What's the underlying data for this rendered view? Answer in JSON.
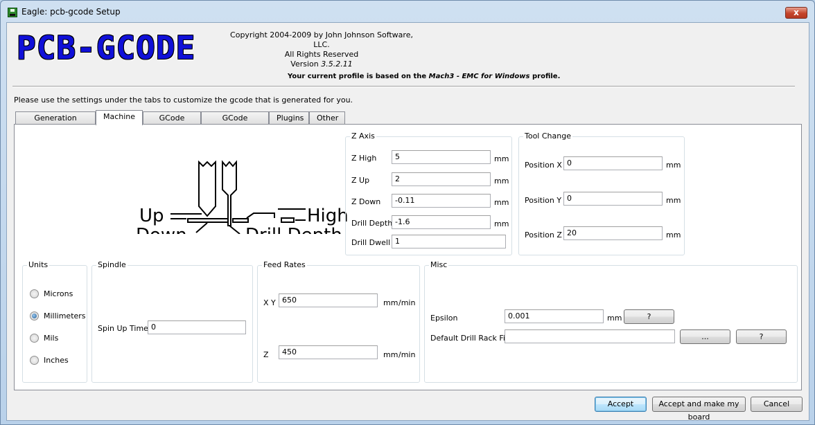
{
  "window": {
    "title": "Eagle: pcb-gcode Setup",
    "close_label": "x"
  },
  "header": {
    "logo_text": "PCB-GCODE",
    "copyright": "Copyright 2004-2009 by John Johnson Software, LLC.",
    "rights": "All Rights Reserved",
    "version_label": "Version",
    "version_value": "3.5.2.11",
    "profile_prefix": "Your current profile is based on the",
    "profile_name": "Mach3 - EMC for Windows",
    "profile_suffix": "profile."
  },
  "instructions": "Please use the settings under the tabs to customize the gcode that is generated for you.",
  "tabs": [
    {
      "label": "Generation Options",
      "active": false
    },
    {
      "label": "Machine",
      "active": true
    },
    {
      "label": "GCode Style",
      "active": false
    },
    {
      "label": "GCode Options",
      "active": false
    },
    {
      "label": "Plugins",
      "active": false
    },
    {
      "label": "Other",
      "active": false
    }
  ],
  "diagram": {
    "labels": {
      "up": "Up",
      "down": "Down",
      "high": "High",
      "drill_depth": "Drill Depth"
    }
  },
  "z_axis": {
    "title": "Z Axis",
    "fields": [
      {
        "label": "Z High",
        "value": "5",
        "unit": "mm"
      },
      {
        "label": "Z Up",
        "value": "2",
        "unit": "mm"
      },
      {
        "label": "Z Down",
        "value": "-0.11",
        "unit": "mm"
      },
      {
        "label": "Drill Depth",
        "value": "-1.6",
        "unit": "mm"
      },
      {
        "label": "Drill Dwell",
        "value": "1",
        "unit": ""
      }
    ]
  },
  "tool_change": {
    "title": "Tool Change",
    "fields": [
      {
        "label": "Position X",
        "value": "0",
        "unit": "mm"
      },
      {
        "label": "Position Y",
        "value": "0",
        "unit": "mm"
      },
      {
        "label": "Position Z",
        "value": "20",
        "unit": "mm"
      }
    ]
  },
  "units": {
    "title": "Units",
    "options": [
      {
        "label": "Microns",
        "checked": false
      },
      {
        "label": "Millimeters",
        "checked": true
      },
      {
        "label": "Mils",
        "checked": false
      },
      {
        "label": "Inches",
        "checked": false
      }
    ]
  },
  "spindle": {
    "title": "Spindle",
    "spin_up_label": "Spin Up Time",
    "spin_up_value": "0"
  },
  "feed_rates": {
    "title": "Feed Rates",
    "xy_label": "X Y",
    "xy_value": "650",
    "xy_unit": "mm",
    "xy_per": "/min",
    "z_label": "Z",
    "z_value": "450",
    "z_unit": "mm",
    "z_per": "/min"
  },
  "misc": {
    "title": "Misc",
    "epsilon_label": "Epsilon",
    "epsilon_value": "0.001",
    "epsilon_unit": "mm",
    "epsilon_help": "?",
    "drill_rack_label": "Default Drill Rack File",
    "drill_rack_value": "",
    "browse_label": "...",
    "drill_rack_help": "?"
  },
  "footer": {
    "accept": "Accept",
    "accept_make": "Accept and make my board",
    "cancel": "Cancel"
  }
}
